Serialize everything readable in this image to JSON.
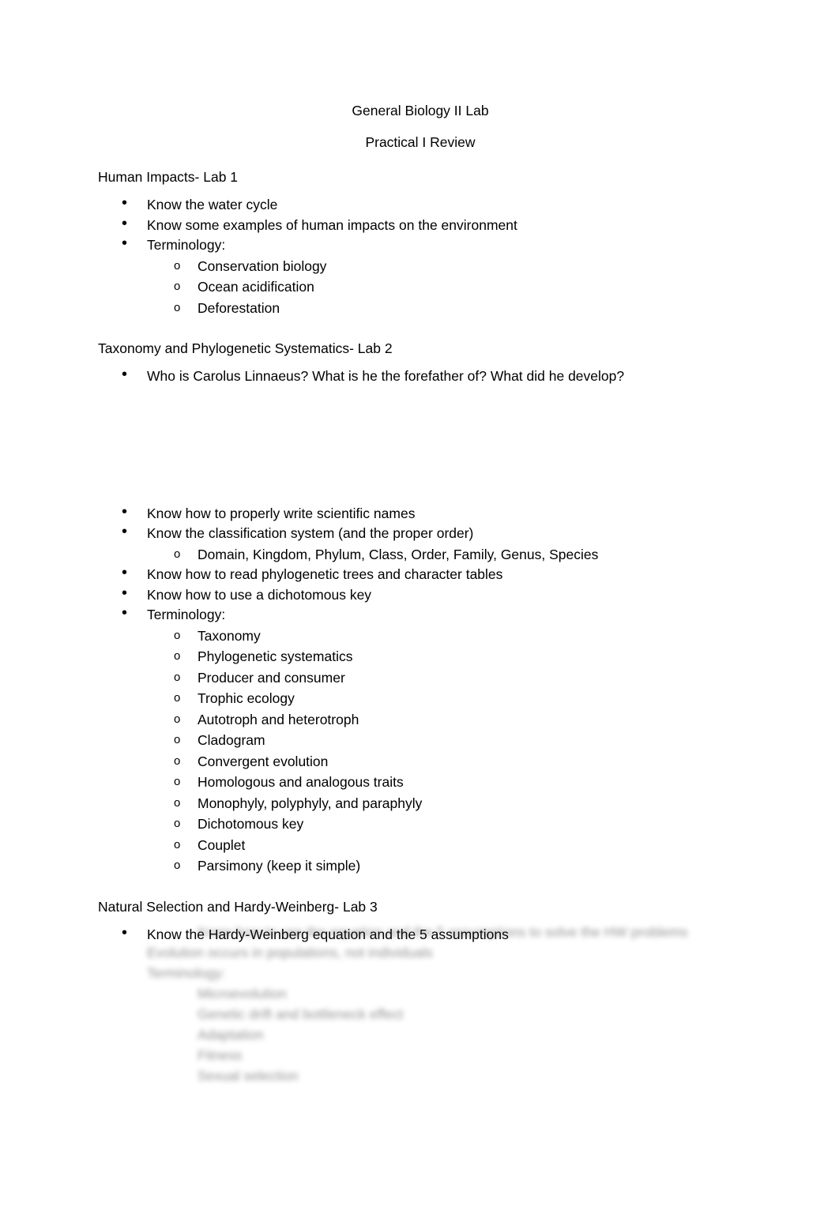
{
  "document": {
    "title": "General Biology II Lab",
    "subtitle": "Practical I Review",
    "sections": [
      {
        "heading": "Human Impacts- Lab 1",
        "items": [
          {
            "text": "Know the water cycle",
            "sub": []
          },
          {
            "text": "Know some examples of human impacts on the environment",
            "sub": []
          },
          {
            "text": "Terminology:",
            "sub": [
              "Conservation biology",
              "Ocean acidification",
              "Deforestation"
            ]
          }
        ]
      },
      {
        "heading": "Taxonomy and Phylogenetic Systematics- Lab 2",
        "items": [
          {
            "text": "Who is Carolus Linnaeus? What is he the forefather of? What did he develop?",
            "sub": []
          }
        ]
      },
      {
        "heading": "",
        "items": [
          {
            "text": "Know how to properly write scientific names",
            "sub": []
          },
          {
            "text": "Know the classification system (and the proper order)",
            "sub": [
              "Domain, Kingdom, Phylum, Class, Order, Family, Genus, Species"
            ]
          },
          {
            "text": "Know how to read phylogenetic trees and character tables",
            "sub": []
          },
          {
            "text": "Know how to use a dichotomous key",
            "sub": []
          },
          {
            "text": "Terminology:",
            "sub": [
              "Taxonomy",
              "Phylogenetic systematics",
              "Producer and consumer",
              "Trophic ecology",
              "Autotroph and heterotroph",
              "Cladogram",
              "Convergent evolution",
              "Homologous and analogous traits",
              "Monophyly, polyphyly, and paraphyly",
              "Dichotomous key",
              "Couplet",
              "Parsimony (keep it simple)"
            ]
          }
        ]
      },
      {
        "heading": "Natural Selection and Hardy-Weinberg- Lab 3",
        "items": [
          {
            "text": "Know the Hardy-Weinberg equation and the 5 assumptions",
            "sub": []
          }
        ]
      }
    ],
    "blurred_lines": [
      "Know how to use the equation and the 5 assumptions to solve the HW problems",
      "Evolution occurs in populations, not individuals",
      "Terminology:",
      "Microevolution",
      "Genetic drift and bottleneck effect",
      "Adaptation",
      "Fitness",
      "Sexual selection"
    ]
  }
}
